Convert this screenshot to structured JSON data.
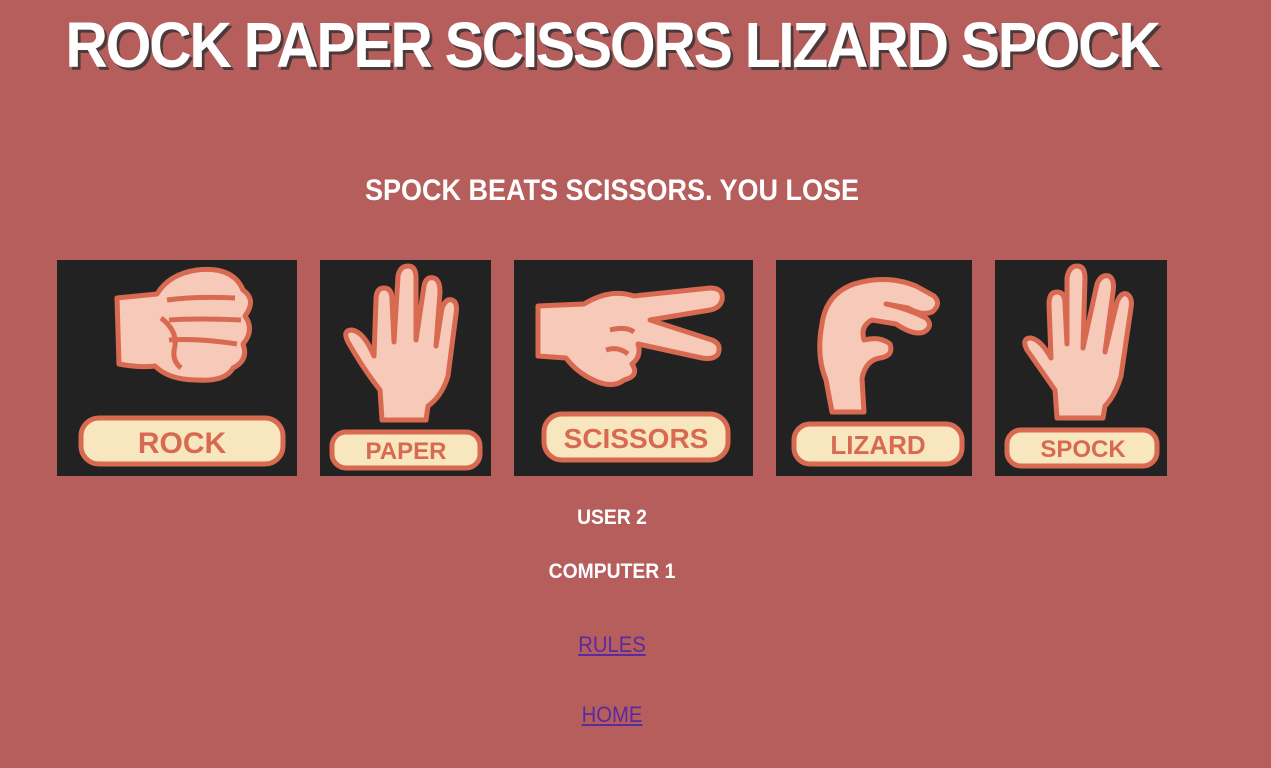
{
  "header": {
    "title": "ROCK PAPER SCISSORS LIZARD SPOCK"
  },
  "result": {
    "message": "SPOCK BEATS SCISSORS. YOU LOSE"
  },
  "choices": [
    {
      "label": "ROCK",
      "icon": "rock-hand-icon"
    },
    {
      "label": "PAPER",
      "icon": "paper-hand-icon"
    },
    {
      "label": "SCISSORS",
      "icon": "scissors-hand-icon"
    },
    {
      "label": "LIZARD",
      "icon": "lizard-hand-icon"
    },
    {
      "label": "SPOCK",
      "icon": "spock-hand-icon"
    }
  ],
  "score": {
    "user": "USER 2",
    "computer": "COMPUTER 1"
  },
  "links": {
    "rules": "RULES",
    "home": "HOME"
  },
  "colors": {
    "background": "#b55e5c",
    "card": "#222222",
    "skin": "#f6c9b8",
    "outline": "#d96a52",
    "badge": "#f8e6bf",
    "link": "#5a2aa0"
  }
}
